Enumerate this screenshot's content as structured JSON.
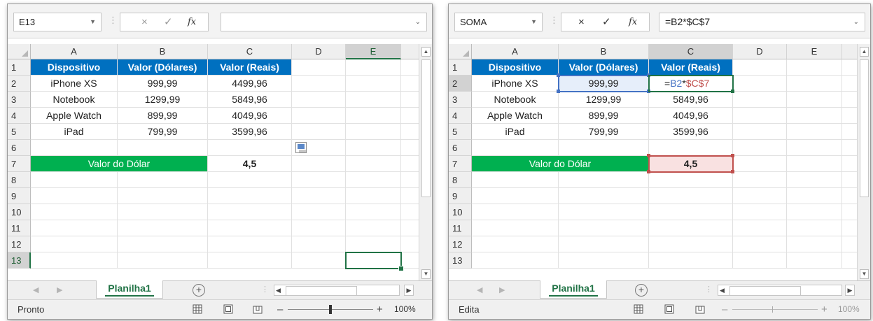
{
  "left": {
    "name_box": "E13",
    "formula": "",
    "columns": [
      "A",
      "B",
      "C",
      "D",
      "E"
    ],
    "rows": [
      "1",
      "2",
      "3",
      "4",
      "5",
      "6",
      "7",
      "8",
      "9",
      "10",
      "11",
      "12",
      "13"
    ],
    "headers": [
      "Dispositivo",
      "Valor (Dólares)",
      "Valor (Reais)"
    ],
    "data": [
      [
        "iPhone XS",
        "999,99",
        "4499,96"
      ],
      [
        "Notebook",
        "1299,99",
        "5849,96"
      ],
      [
        "Apple Watch",
        "899,99",
        "4049,96"
      ],
      [
        "iPad",
        "799,99",
        "3599,96"
      ]
    ],
    "label_dolar": "Valor do Dólar",
    "dolar_value": "4,5",
    "sheet_tab": "Planilha1",
    "status": "Pronto",
    "zoom": "100%"
  },
  "right": {
    "name_box": "SOMA",
    "formula": "=B2*$C$7",
    "columns": [
      "A",
      "B",
      "C",
      "D",
      "E"
    ],
    "rows": [
      "1",
      "2",
      "3",
      "4",
      "5",
      "6",
      "7",
      "8",
      "9",
      "10",
      "11",
      "12",
      "13"
    ],
    "headers": [
      "Dispositivo",
      "Valor (Dólares)",
      "Valor (Reais)"
    ],
    "data": [
      [
        "iPhone XS",
        "999,99",
        ""
      ],
      [
        "Notebook",
        "1299,99",
        "5849,96"
      ],
      [
        "Apple Watch",
        "899,99",
        "4049,96"
      ],
      [
        "iPad",
        "799,99",
        "3599,96"
      ]
    ],
    "edit_eq": "=",
    "edit_ref1": "B2",
    "edit_op": "*",
    "edit_ref2": "$C$7",
    "label_dolar": "Valor do Dólar",
    "dolar_value": "4,5",
    "sheet_tab": "Planilha1",
    "status": "Edita",
    "zoom": "100%"
  },
  "icons": {
    "cancel": "×",
    "enter": "✓",
    "fx": "fx",
    "add_sheet": "+",
    "dropdown": "▼",
    "chevron": "⌄"
  },
  "colors": {
    "header_blue": "#0070c0",
    "label_green": "#00b050",
    "excel_green": "#217346",
    "ref_blue": "#4472c4",
    "ref_red": "#c0504d"
  }
}
